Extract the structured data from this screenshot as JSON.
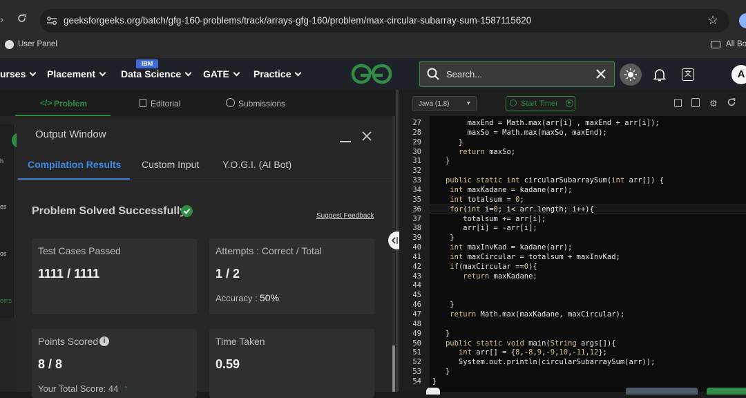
{
  "browser": {
    "url": "geeksforgeeks.org/batch/gfg-160-problems/track/arrays-gfg-160/problem/max-circular-subarray-sum-1587115620",
    "bookmark_user_panel": "User Panel",
    "bookmark_all": "All Bo"
  },
  "header": {
    "nav": [
      "urses",
      "Placement",
      "Data Science",
      "GATE",
      "Practice"
    ],
    "ibm_badge": "IBM",
    "logo": "GG",
    "search_placeholder": "Search...",
    "avatar_letter": "A"
  },
  "problem_tabs": [
    "Problem",
    "Editorial",
    "Submissions"
  ],
  "side_rail": [
    "h",
    "es",
    "os",
    "ems"
  ],
  "output_window": {
    "title": "Output Window",
    "tabs": [
      "Compilation Results",
      "Custom Input",
      "Y.O.G.I. (AI Bot)"
    ],
    "status": "Problem Solved Successfully",
    "suggest": "Suggest Feedback",
    "cards": {
      "test_cases_label": "Test Cases Passed",
      "test_cases_value": "1111 / 1111",
      "attempts_label": "Attempts : Correct / Total",
      "attempts_value": "1 / 2",
      "accuracy_label": "Accuracy :",
      "accuracy_value": "50%",
      "points_label": "Points Scored",
      "points_value": "8 / 8",
      "total_score": "Your Total Score: 44",
      "time_label": "Time Taken",
      "time_value": "0.59"
    }
  },
  "editor": {
    "language": "Java (1.8)",
    "timer": "Start Timer",
    "line_numbers": [
      "27",
      "28",
      "29",
      "30",
      "31",
      "32",
      "33",
      "34",
      "35",
      "36",
      "37",
      "38",
      "39",
      "40",
      "41",
      "42",
      "43",
      "44",
      "45",
      "46",
      "47",
      "48",
      "49",
      "50",
      "51",
      "52",
      "53",
      "54"
    ],
    "lines": [
      "        maxEnd = Math.max(arr[i] , maxEnd + arr[i]);",
      "        maxSo = Math.max(maxSo, maxEnd);",
      "      }",
      "      return maxSo;",
      "   }",
      "",
      "   public static int circularSubarraySum(int arr[]) {",
      "    int maxKadane = kadane(arr);",
      "    int totalsum = 0;",
      "    for(int i=0; i< arr.length; i++){",
      "       totalsum += arr[i];",
      "       arr[i] = -arr[i];",
      "    }",
      "    int maxInvKad = kadane(arr);",
      "    int maxCircular = totalsum + maxInvKad;",
      "    if(maxCircular ==0){",
      "       return maxKadane;",
      "",
      "",
      "    }",
      "    return Math.max(maxKadane, maxCircular);",
      "",
      "   }",
      "   public static void main(String args[]){",
      "      int arr[] = {8,-8,9,-9,10,-11,12};",
      "      System.out.println(circularSubarraySum(arr));",
      "   }",
      "}"
    ]
  }
}
